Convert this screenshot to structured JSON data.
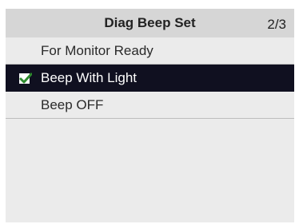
{
  "header": {
    "title": "Diag Beep Set",
    "page_indicator": "2/3"
  },
  "menu": {
    "items": [
      {
        "label": "For Monitor Ready",
        "selected": false,
        "checked": false
      },
      {
        "label": "Beep With Light",
        "selected": true,
        "checked": true,
        "icon": "checkmark-icon"
      },
      {
        "label": "Beep OFF",
        "selected": false,
        "checked": false
      }
    ]
  },
  "colors": {
    "header_bg": "#d6d6d6",
    "body_bg": "#ebebeb",
    "selected_bg": "#101020",
    "check_green": "#2e8b2e"
  }
}
